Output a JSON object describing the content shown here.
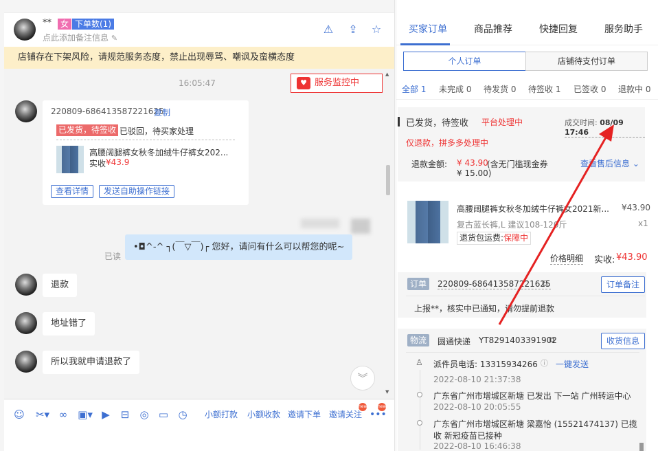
{
  "header": {
    "nickname": "**",
    "gender_tag": "女",
    "order_count_tag": "下单数(1)",
    "remark_placeholder": "点此添加备注信息"
  },
  "warning": "店铺存在下架风险，请规范服务态度，禁止出现辱骂、嘲讽及蛮横态度",
  "chat": {
    "time": "16:05:47",
    "monitor_label": "服务监控中",
    "card": {
      "order_no": "220809-686413587221625",
      "copy": "复制",
      "status_tag": "已发货，待签收",
      "status_note": "已驳回，待买家处理",
      "product_name": "高腰阔腿裤女秋冬加绒牛仔裤女202...",
      "paid_label": "实收",
      "paid_value": "¥43.9",
      "btn_detail": "查看详情",
      "btn_link": "发送自助操作链接"
    },
    "outgoing": "•◘^-^ ┐(￣▽￣)┌ 您好，请问有什么可以帮您的呢~",
    "read": "已读",
    "messages": [
      "退款",
      "地址错了",
      "所以我就申请退款了"
    ]
  },
  "toolbar": {
    "links": [
      "小额打款",
      "小额收款",
      "邀请下单",
      "邀请关注"
    ],
    "new_badge": "new"
  },
  "right": {
    "tabs": [
      "买家订单",
      "商品推荐",
      "快捷回复",
      "服务助手"
    ],
    "seg": [
      "个人订单",
      "店铺待支付订单"
    ],
    "filters": [
      "全部 1",
      "未完成 0",
      "待发货 0",
      "待签收 1",
      "已签收 0",
      "退款中 0"
    ],
    "order": {
      "status": "已发货，待签收",
      "platform": "平台处理中",
      "deal_label": "成交时间: ",
      "deal_time": "08/09 17:46",
      "refund_type": "仅退款，拼多多处理中",
      "refund_label": "退款金额:",
      "refund_amount": "¥ 43.90",
      "refund_note": "(含无门槛现金券",
      "refund_coupon": "¥ 15.00)",
      "aftersale_link": "查看售后信息"
    },
    "product": {
      "name": "高腰阔腿裤女秋冬加绒牛仔裤女2021新...",
      "price": "¥43.90",
      "spec": "复古蓝长裤,L 建议108-120斤",
      "qty": "x1",
      "tag_label": "退货包运费:",
      "tag_value": "保障中",
      "price_detail": "价格明细",
      "paid_label": "实收:",
      "paid_value": "¥43.90"
    },
    "order_info": {
      "tag": "订单",
      "order_no": "220809-686413587221625",
      "btn": "订单备注",
      "note": "上报**，核实中已通知，请勿提前退款"
    },
    "logistics": {
      "tag": "物流",
      "company": "圆通快递",
      "tracking_no": "YT8291403391902",
      "btn": "收货信息",
      "courier_label": "派件员电话: 13315934266",
      "send_link": "一键发送",
      "courier_time": "2022-08-10 21:37:38",
      "events": [
        {
          "text": "广东省广州市增城区新塘 已发出 下一站 广州转运中心",
          "time": "2022-08-10 20:05:55"
        },
        {
          "text": "广东省广州市增城区新塘 梁嘉怡 (15521474137) 已揽",
          "text2": "收 新冠疫苗已接种",
          "time": "2022-08-10 16:46:38"
        }
      ]
    }
  }
}
